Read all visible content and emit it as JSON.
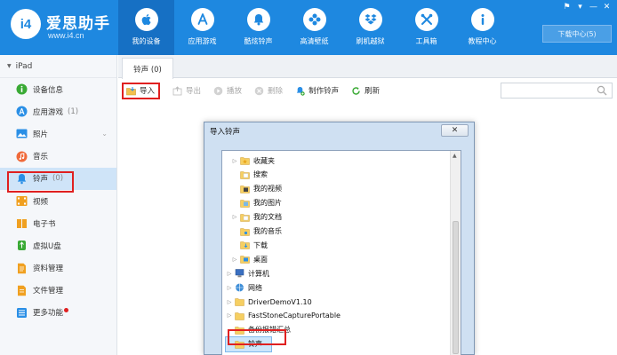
{
  "brand": {
    "logo": "i4",
    "title": "爱思助手",
    "url": "www.i4.cn"
  },
  "nav": [
    {
      "label": "我的设备",
      "icon": "apple-icon",
      "active": true
    },
    {
      "label": "应用游戏",
      "icon": "appstore-icon",
      "active": false
    },
    {
      "label": "酷炫铃声",
      "icon": "bell-icon",
      "active": false
    },
    {
      "label": "高清壁纸",
      "icon": "flower-icon",
      "active": false
    },
    {
      "label": "刷机越狱",
      "icon": "dropbox-icon",
      "active": false
    },
    {
      "label": "工具箱",
      "icon": "tools-icon",
      "active": false
    },
    {
      "label": "教程中心",
      "icon": "info-icon",
      "active": false
    }
  ],
  "download_center": "下载中心(5)",
  "window_controls": [
    "⚑",
    "▾",
    "—",
    "✕"
  ],
  "device": {
    "name": "iPad"
  },
  "sidebar": [
    {
      "label": "设备信息",
      "count": "",
      "icon": "info-circle-icon",
      "color": "#3aaa35"
    },
    {
      "label": "应用游戏",
      "count": "(1)",
      "icon": "apps-icon",
      "color": "#2a8fe6"
    },
    {
      "label": "照片",
      "count": "",
      "icon": "photo-icon",
      "color": "#2a8fe6"
    },
    {
      "label": "音乐",
      "count": "",
      "icon": "music-icon",
      "color": "#f06a3a"
    },
    {
      "label": "铃声",
      "count": "(0)",
      "icon": "bell-icon",
      "color": "#2a8fe6",
      "active": true
    },
    {
      "label": "视频",
      "count": "",
      "icon": "video-icon",
      "color": "#f0a020"
    },
    {
      "label": "电子书",
      "count": "",
      "icon": "book-icon",
      "color": "#f0a020"
    },
    {
      "label": "虚拟U盘",
      "count": "",
      "icon": "usb-icon",
      "color": "#3aaa35"
    },
    {
      "label": "资料管理",
      "count": "",
      "icon": "document-icon",
      "color": "#f0a020"
    },
    {
      "label": "文件管理",
      "count": "",
      "icon": "folder-file-icon",
      "color": "#f0a020"
    },
    {
      "label": "更多功能",
      "count": "",
      "icon": "grid-icon",
      "color": "#2a8fe6",
      "badge": true
    }
  ],
  "tab": {
    "label": "铃声 (0)"
  },
  "toolbar": [
    {
      "label": "导入",
      "icon": "import-folder-icon",
      "enabled": true
    },
    {
      "label": "导出",
      "icon": "export-icon",
      "enabled": false
    },
    {
      "label": "播放",
      "icon": "play-icon",
      "enabled": false
    },
    {
      "label": "删除",
      "icon": "delete-icon",
      "enabled": false
    },
    {
      "label": "制作铃声",
      "icon": "make-ringtone-icon",
      "enabled": true
    },
    {
      "label": "刷新",
      "icon": "refresh-icon",
      "enabled": true
    }
  ],
  "dialog": {
    "title": "导入铃声",
    "close": "✕",
    "tree": [
      {
        "label": "收藏夹",
        "level": 1,
        "expandable": true,
        "icon": "star-folder-icon"
      },
      {
        "label": "搜索",
        "level": 1,
        "expandable": false,
        "icon": "search-folder-icon"
      },
      {
        "label": "我的视频",
        "level": 1,
        "expandable": false,
        "icon": "video-folder-icon"
      },
      {
        "label": "我的图片",
        "level": 1,
        "expandable": false,
        "icon": "picture-folder-icon"
      },
      {
        "label": "我的文档",
        "level": 1,
        "expandable": true,
        "icon": "document-folder-icon"
      },
      {
        "label": "我的音乐",
        "level": 1,
        "expandable": false,
        "icon": "music-folder-icon"
      },
      {
        "label": "下载",
        "level": 1,
        "expandable": false,
        "icon": "download-folder-icon"
      },
      {
        "label": "桌面",
        "level": 1,
        "expandable": true,
        "icon": "desktop-folder-icon"
      },
      {
        "label": "计算机",
        "level": 0,
        "expandable": true,
        "icon": "computer-icon"
      },
      {
        "label": "网络",
        "level": 0,
        "expandable": true,
        "icon": "network-icon"
      },
      {
        "label": "DriverDemoV1.10",
        "level": 0,
        "expandable": true,
        "icon": "folder-icon"
      },
      {
        "label": "FastStoneCapturePortable",
        "level": 0,
        "expandable": true,
        "icon": "folder-icon"
      },
      {
        "label": "备份报错汇总",
        "level": 0,
        "expandable": false,
        "icon": "folder-icon"
      },
      {
        "label": "铃声",
        "level": 0,
        "expandable": false,
        "icon": "folder-icon",
        "selected": true
      }
    ]
  },
  "colors": {
    "topbar": "#1e88e0",
    "active_nav": "#1670c4",
    "highlight": "#e02020",
    "sidebar_active": "#cfe4f8"
  }
}
